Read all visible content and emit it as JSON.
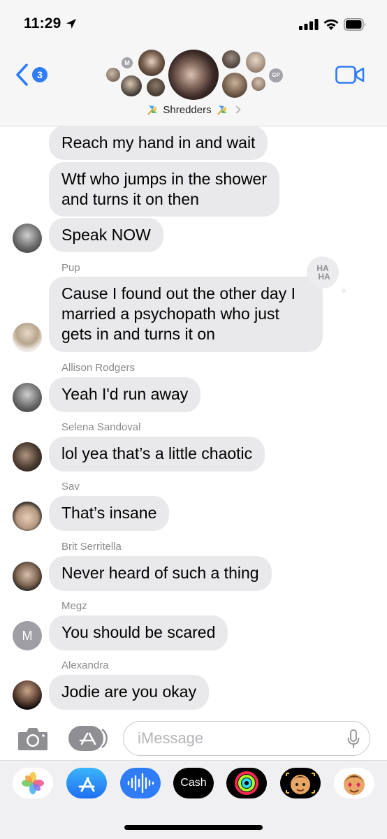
{
  "status_bar": {
    "time": "11:29"
  },
  "header": {
    "back_count": "3",
    "group_name": "Shredders",
    "avatar_initials": [
      "M",
      "GP"
    ]
  },
  "messages": [
    {
      "sender": "",
      "text": "Reach my hand in and wait"
    },
    {
      "sender": "",
      "text": "Wtf who jumps in the shower\nand turns it on then"
    },
    {
      "sender": "",
      "text": "Speak NOW"
    },
    {
      "sender": "Pup",
      "text": "Cause I found out the other day I\nmarried a psychopath who just\ngets in and turns it on",
      "tapback": "HA HA"
    },
    {
      "sender": "Allison Rodgers",
      "text": "Yeah I'd run away"
    },
    {
      "sender": "Selena Sandoval",
      "text": "lol yea that’s a little chaotic"
    },
    {
      "sender": "Sav",
      "text": "That’s insane"
    },
    {
      "sender": "Brit Serritella",
      "text": "Never heard of such a thing"
    },
    {
      "sender": "Megz",
      "text": "You should be scared",
      "avatar_initial": "M"
    },
    {
      "sender": "Alexandra",
      "text": "Jodie are you okay"
    }
  ],
  "composer": {
    "placeholder": "iMessage"
  },
  "app_drawer": {
    "apps": [
      "photos-icon",
      "app-store-icon",
      "audio-message-icon",
      "cash-icon",
      "activity-icon",
      "memoji-icon",
      "memoji-stickers-icon"
    ],
    "cash_label": "Cash"
  },
  "colors": {
    "accent": "#2f7cf6",
    "bubble_gray": "#e9e9eb",
    "sender_gray": "#8a8a8e",
    "header_bg": "#f6f6f6"
  }
}
